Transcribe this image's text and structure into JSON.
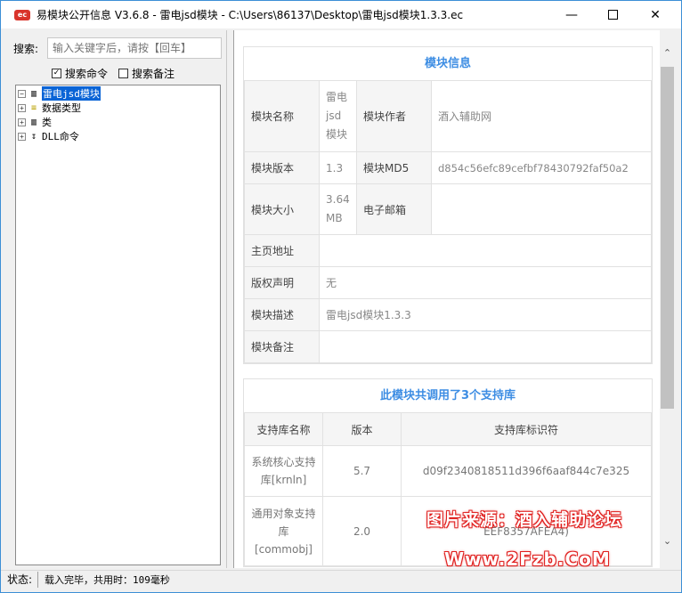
{
  "window": {
    "title": "易模块公开信息 V3.6.8 - 雷电jsd模块 - C:\\Users\\86137\\Desktop\\雷电jsd模块1.3.3.ec",
    "app_icon_text": "ec"
  },
  "search": {
    "label": "搜索:",
    "placeholder": "输入关键字后，请按【回车】",
    "options": [
      {
        "label": "搜索命令",
        "checked": true
      },
      {
        "label": "搜索备注",
        "checked": false
      }
    ]
  },
  "tree": {
    "root": "雷电jsd模块",
    "children": [
      "数据类型",
      "类",
      "DLL命令"
    ]
  },
  "module_info": {
    "title": "模块信息",
    "name_label": "模块名称",
    "name": "雷电\njsd\n模块",
    "author_label": "模块作者",
    "author": "酒入辅助网",
    "version_label": "模块版本",
    "version": "1.3",
    "md5_label": "模块MD5",
    "md5": "d854c56efc89cefbf78430792faf50a2",
    "size_label": "模块大小",
    "size": "3.64\nMB",
    "email_label": "电子邮箱",
    "email": "",
    "homepage_label": "主页地址",
    "homepage": "",
    "copyright_label": "版权声明",
    "copyright": "无",
    "desc_label": "模块描述",
    "desc": "雷电jsd模块1.3.3",
    "note_label": "模块备注",
    "note": ""
  },
  "support": {
    "title": "此模块共调用了3个支持库",
    "headers": [
      "支持库名称",
      "版本",
      "支持库标识符"
    ],
    "rows": [
      {
        "name": "系统核心支持库[krnln]",
        "version": "5.7",
        "id": "d09f2340818511d396f6aaf844c7e325"
      },
      {
        "name": "通用对象支持库[commobj]",
        "version": "2.0",
        "id": "EEF8357AFEA4)"
      }
    ]
  },
  "status": {
    "label": "状态:",
    "text": "载入完毕，共用时：109毫秒"
  },
  "watermark": {
    "line1": "图片来源：酒入辅助论坛",
    "line2": "Www.2Fzb.CoM"
  },
  "colors": {
    "accent": "#3d8de3",
    "selection": "#0a64d6",
    "watermark_outline": "#e0201f"
  }
}
